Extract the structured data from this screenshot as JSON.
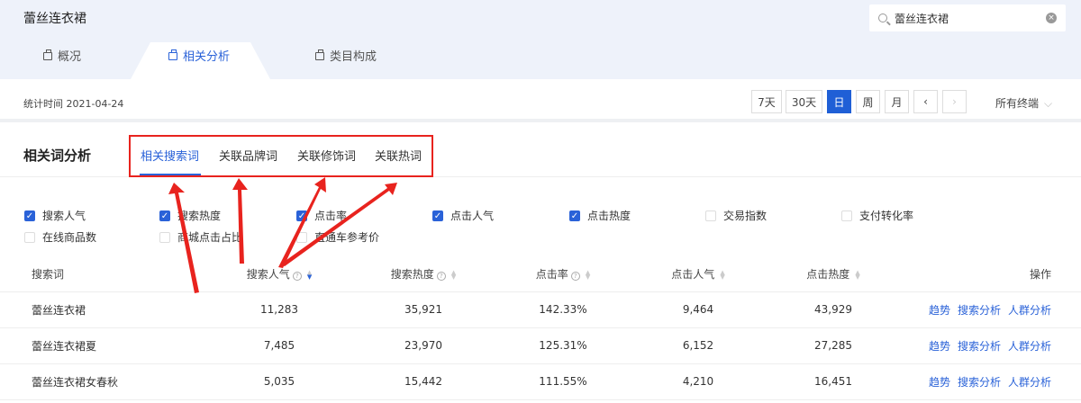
{
  "header": {
    "title": "蕾丝连衣裙",
    "search_value": "蕾丝连衣裙"
  },
  "tabs": [
    {
      "label": "概况"
    },
    {
      "label": "相关分析"
    },
    {
      "label": "类目构成"
    }
  ],
  "date": {
    "label": "统计时间 2021-04-24",
    "ranges": [
      "7天",
      "30天",
      "日",
      "周",
      "月"
    ],
    "prev": "‹",
    "next": "›",
    "terminal": "所有终端"
  },
  "section": {
    "title": "相关词分析",
    "subtabs": [
      "相关搜索词",
      "关联品牌词",
      "关联修饰词",
      "关联热词"
    ]
  },
  "metrics": [
    {
      "label": "搜索人气",
      "checked": true
    },
    {
      "label": "搜索热度",
      "checked": true
    },
    {
      "label": "点击率",
      "checked": true
    },
    {
      "label": "点击人气",
      "checked": true
    },
    {
      "label": "点击热度",
      "checked": true
    },
    {
      "label": "交易指数",
      "checked": false
    },
    {
      "label": "支付转化率",
      "checked": false
    },
    {
      "label": "在线商品数",
      "checked": false
    },
    {
      "label": "商城点击占比",
      "checked": false
    },
    {
      "label": "直通车参考价",
      "checked": false
    }
  ],
  "table": {
    "headers": [
      "搜索词",
      "搜索人气",
      "搜索热度",
      "点击率",
      "点击人气",
      "点击热度",
      "操作"
    ],
    "rows": [
      [
        "蕾丝连衣裙",
        "11,283",
        "35,921",
        "142.33%",
        "9,464",
        "43,929"
      ],
      [
        "蕾丝连衣裙夏",
        "7,485",
        "23,970",
        "125.31%",
        "6,152",
        "27,285"
      ],
      [
        "蕾丝连衣裙女春秋",
        "5,035",
        "15,442",
        "111.55%",
        "4,210",
        "16,451"
      ]
    ],
    "actions": [
      "趋势",
      "搜索分析",
      "人群分析"
    ]
  },
  "colors": {
    "accent": "#2a62d8",
    "annotation": "#e8231e"
  }
}
